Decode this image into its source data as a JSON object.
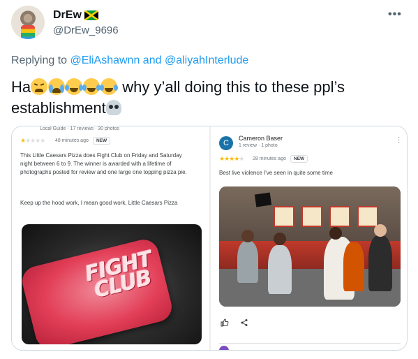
{
  "tweet": {
    "display_name": "DrEw",
    "handle": "@DrEw_9696",
    "more_label": "•••",
    "reply_prefix": "Replying to",
    "reply_mention_1": "@EliAshawnn",
    "reply_and": "and",
    "reply_mention_2": "@aliyahInterlude",
    "text_start": "Ha",
    "text_mid": "why y’all doing this to these ppl’s",
    "text_end": "establishment",
    "emojis": [
      "tired-face-icon",
      "loudly-crying-face-icon",
      "face-with-tears-of-joy-icon",
      "face-with-tears-of-joy-icon",
      "face-with-tears-of-joy-icon",
      "skull-icon"
    ],
    "flag": "jamaica-flag-icon"
  },
  "review_left": {
    "header_meta": "Local Guide · 17 reviews · 30 photos",
    "rating": 1,
    "time": "48 minutes ago",
    "badge": "NEW",
    "body_1": "This Little Caesars Pizza does Fight Club on Friday and Saturday night between 6 to 9. The winner is awarded with a lifetime of photographs posted for review and one large one topping pizza pie.",
    "body_2": "Keep up the hood work, I mean good work, Little Caesars Pizza",
    "image_text_1": "FIGHT",
    "image_text_2": "CLUB"
  },
  "review_right": {
    "avatar_letter": "C",
    "name": "Cameron Baser",
    "sub": "1 review · 1 photo",
    "rating": 4,
    "time": "28 minutes ago",
    "badge": "NEW",
    "body": "Best live violence I've seen in quite some time"
  },
  "colors": {
    "link_blue": "#1d9bf0",
    "muted_text": "#536471",
    "star_yellow": "#fbbc04"
  }
}
